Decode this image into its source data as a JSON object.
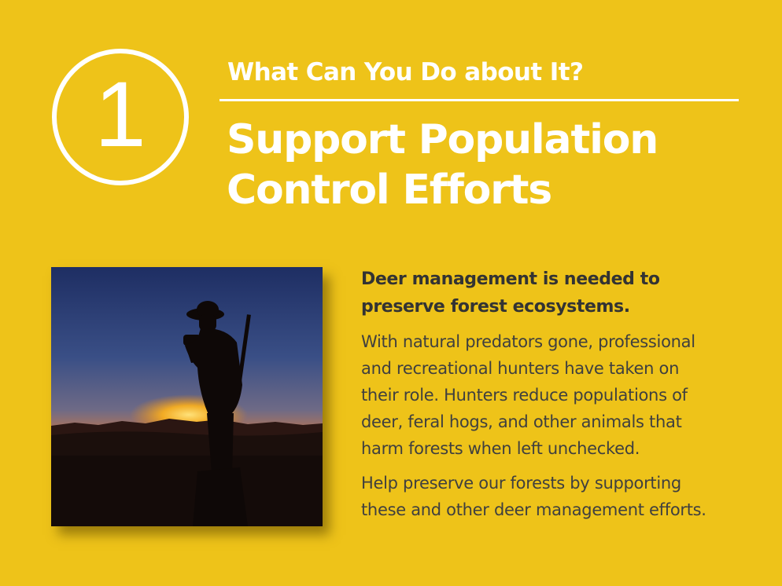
{
  "slide": {
    "step_number": "1",
    "kicker": "What Can You Do about It?",
    "headline_lines": [
      "Support Population",
      "Control Efforts"
    ],
    "lead": [
      "Deer management is needed to",
      "preserve forest ecosystems."
    ],
    "body_paragraph_1": [
      "With natural predators gone, professional",
      "and recreational hunters have taken on",
      "their role. Hunters reduce populations of",
      "deer, feral hogs, and other animals that",
      "harm forests when left unchecked."
    ],
    "body_paragraph_2": [
      "Help preserve our forests by supporting",
      "these and other deer management efforts."
    ]
  },
  "colors": {
    "background": "#EEC319",
    "heading_text": "#FFFFFF",
    "body_text": "#3F3F3F"
  },
  "photo": {
    "subject": "hunter-silhouette-at-sunset"
  }
}
